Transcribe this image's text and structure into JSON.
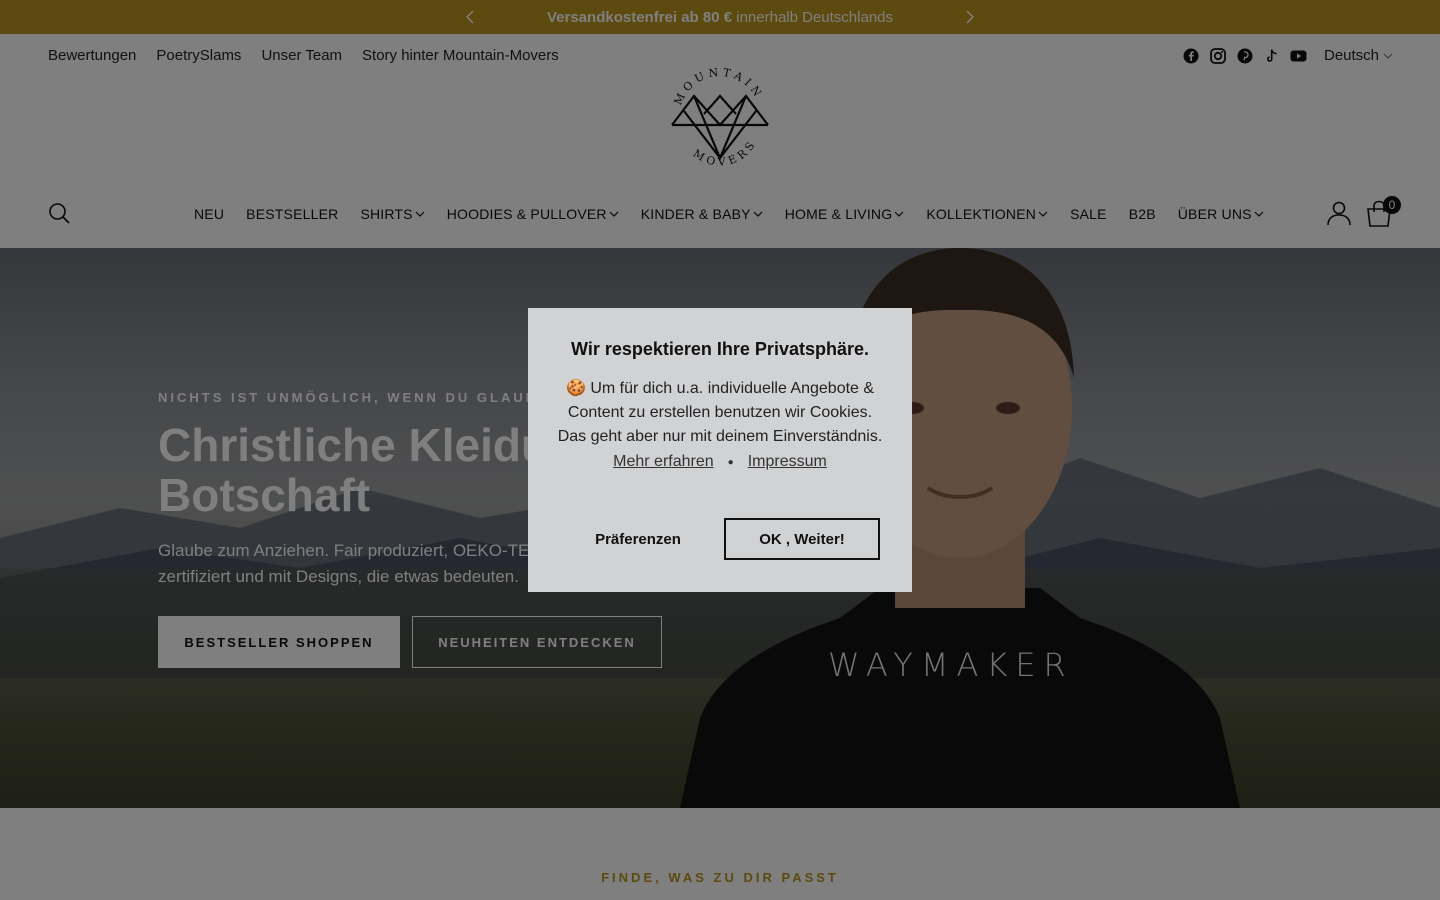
{
  "announcement": {
    "bold_text": "Versandkostenfrei ab 80 €",
    "text": " innerhalb Deutschlands",
    "prev_icon": "chevron-left-icon",
    "next_icon": "chevron-right-icon"
  },
  "topnav": {
    "links": [
      "Bewertungen",
      "PoetrySlams",
      "Unser Team",
      "Story hinter Mountain-Movers"
    ],
    "social_icons": [
      "facebook-icon",
      "instagram-icon",
      "pinterest-icon",
      "tiktok-icon",
      "youtube-icon"
    ],
    "language": "Deutsch"
  },
  "logo": {
    "top_text": "MOUNTAIN",
    "bottom_text": "MOVERS"
  },
  "mainnav": {
    "items": [
      {
        "label": "NEU",
        "dropdown": false
      },
      {
        "label": "BESTSELLER",
        "dropdown": false
      },
      {
        "label": "SHIRTS",
        "dropdown": true
      },
      {
        "label": "HOODIES & PULLOVER",
        "dropdown": true
      },
      {
        "label": "KINDER & BABY",
        "dropdown": true
      },
      {
        "label": "HOME & LIVING",
        "dropdown": true
      },
      {
        "label": "KOLLEKTIONEN",
        "dropdown": true
      },
      {
        "label": "SALE",
        "dropdown": false
      },
      {
        "label": "B2B",
        "dropdown": false
      },
      {
        "label": "ÜBER UNS",
        "dropdown": true
      }
    ],
    "cart_count": "0"
  },
  "hero": {
    "kicker": "NICHTS IST UNMÖGLICH, WENN DU GLAUBST",
    "title": "Christliche Kleidung mit Botschaft",
    "subtitle": "Glaube zum Anziehen. Fair produziert, OEKO-TEX® zertifiziert und mit Designs, die etwas bedeuten.",
    "primary_button": "BESTSELLER SHOPPEN",
    "secondary_button": "NEUHEITEN ENTDECKEN",
    "shirt_print": "WAYMAKER"
  },
  "section": {
    "kicker": "FINDE, WAS ZU DIR PASST"
  },
  "cookie_modal": {
    "title": "Wir respektieren Ihre Privatsphäre.",
    "body": "🍪 Um für dich u.a. individuelle Angebote & Content zu erstellen benutzen wir Cookies. Das geht aber nur mit deinem Einverständnis.",
    "link_more": "Mehr erfahren",
    "separator": "●",
    "link_imprint": "Impressum",
    "preferences_button": "Präferenzen",
    "ok_button": "OK , Weiter!"
  },
  "colors": {
    "accent": "#b8941c",
    "overlay": "rgba(0,0,0,0.5)",
    "modal_bg": "#d1d2d4"
  }
}
